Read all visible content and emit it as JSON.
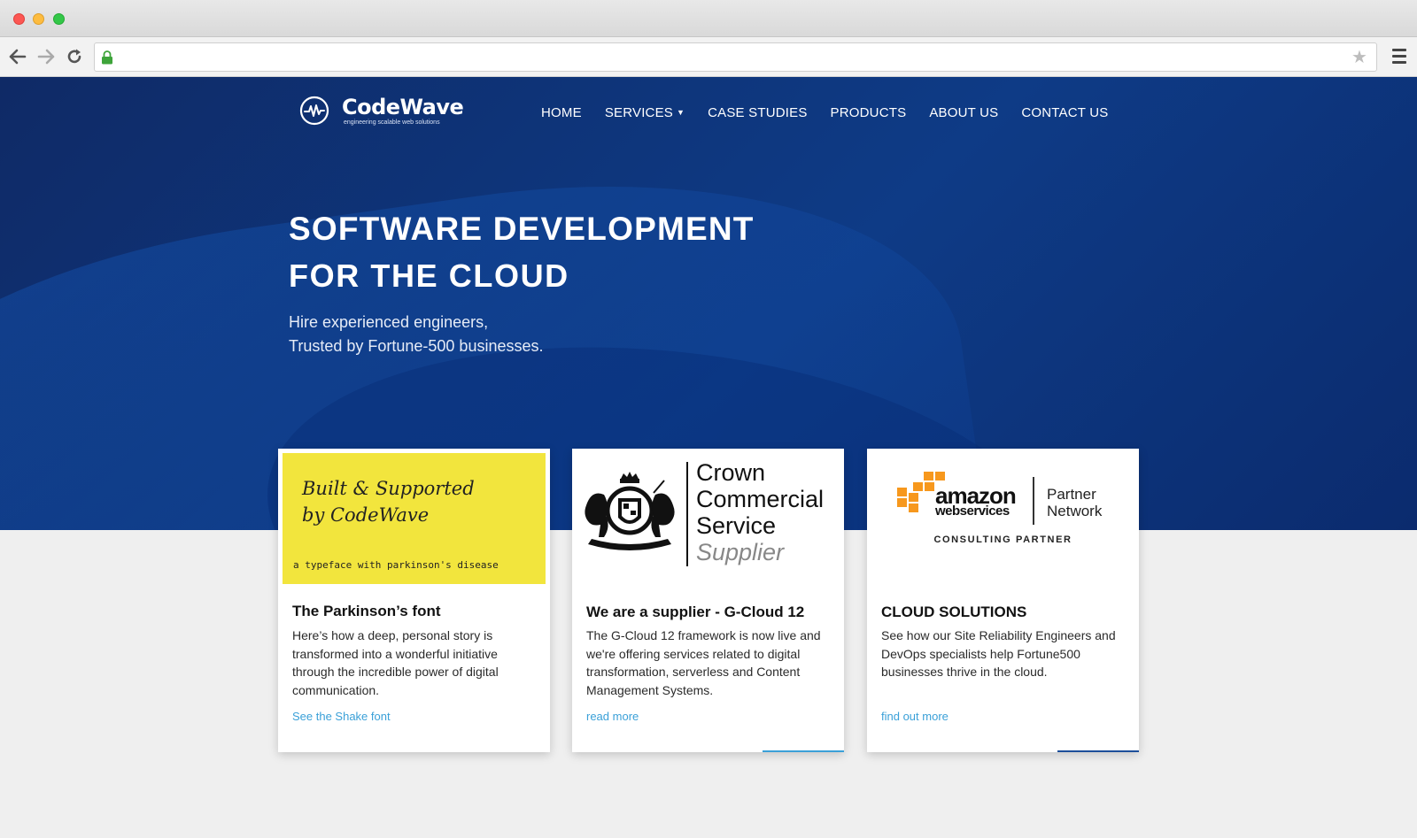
{
  "browser": {
    "url": "",
    "star_glyph": "★"
  },
  "brand": {
    "name": "CodeWave",
    "tagline": "engineering scalable web solutions"
  },
  "nav": {
    "items": [
      {
        "label": "HOME"
      },
      {
        "label": "SERVICES",
        "has_dropdown": true
      },
      {
        "label": "CASE STUDIES"
      },
      {
        "label": "PRODUCTS"
      },
      {
        "label": "ABOUT US"
      },
      {
        "label": "CONTACT US"
      }
    ]
  },
  "hero": {
    "title_line1": "SOFTWARE DEVELOPMENT",
    "title_line2": "FOR THE CLOUD",
    "sub_line1": "Hire experienced engineers,",
    "sub_line2": "Trusted by Fortune-500 businesses."
  },
  "cards": [
    {
      "image": {
        "hand_line1": "Built & Supported",
        "hand_line2": "by CodeWave",
        "mono_line": "a typeface with parkinson's disease",
        "background_color": "#f2e53d"
      },
      "title": "The Parkinson’s font",
      "text": "Here’s how a deep, personal story is transformed into a wonderful initiative through the incredible power of digital communication.",
      "link": "See the Shake font"
    },
    {
      "image": {
        "line1": "Crown",
        "line2": "Commercial",
        "line3": "Service",
        "line4": "Supplier"
      },
      "title": "We are a supplier - G-Cloud 12",
      "text": "The G-Cloud 12 framework is now live and we're offering services related to digital transformation, serverless and Content Management Systems.",
      "link": "read more"
    },
    {
      "image": {
        "word": "amazon",
        "sub": "webservices",
        "partner_line1": "Partner",
        "partner_line2": "Network",
        "consulting": "CONSULTING PARTNER"
      },
      "title": "CLOUD SOLUTIONS",
      "text": "See how our Site Reliability Engineers and DevOps specialists help Fortune500 businesses thrive in the cloud.",
      "link": "find out more"
    }
  ],
  "colors": {
    "hero_dark": "#0f2a66",
    "hero_mid": "#0e3b86",
    "link": "#3aa0d8",
    "page_bg": "#efefef",
    "aws_orange": "#f7981d"
  }
}
